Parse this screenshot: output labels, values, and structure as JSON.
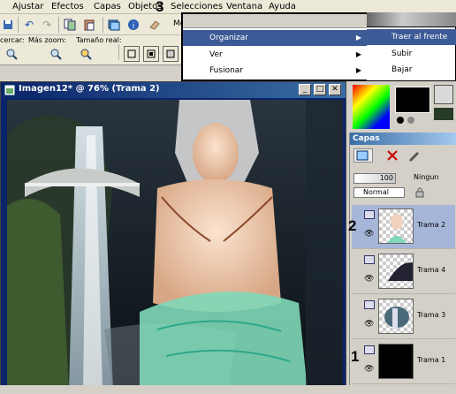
{
  "menubar": {
    "items": [
      "Ajustar",
      "Efectos",
      "Capas",
      "Objetos",
      "Selecciones",
      "Ventana",
      "Ayuda"
    ]
  },
  "toolbar": {
    "labels": [
      "cercar:",
      "Más zoom:",
      "Tamaño real:"
    ],
    "cut_text": "Mo"
  },
  "context_menu": {
    "items": [
      {
        "label": "Organizar",
        "has_submenu": true,
        "selected": true
      },
      {
        "label": "Ver",
        "has_submenu": true,
        "selected": false
      },
      {
        "label": "Fusionar",
        "has_submenu": true,
        "selected": false
      }
    ],
    "submenu": [
      {
        "label": "Traer al frente",
        "selected": true
      },
      {
        "label": "Subir",
        "selected": false
      },
      {
        "label": "Bajar",
        "selected": false
      }
    ]
  },
  "image_window": {
    "title": "Imagen12* @  76% (Trama 2)"
  },
  "layers_panel": {
    "title": "Capas",
    "opacity": "100",
    "blend_mode": "Normal",
    "mask_label": "Ningun",
    "layers": [
      {
        "name": "Trama 2",
        "active": true
      },
      {
        "name": "Trama 4",
        "active": false
      },
      {
        "name": "Trama 3",
        "active": false
      },
      {
        "name": "Trama 1",
        "active": false
      }
    ]
  },
  "steps": [
    "3",
    "2",
    "1"
  ],
  "colors": {
    "selection": "#3c5a96",
    "title_bar": "#0a246a",
    "active_layer": "#a6b6d8"
  }
}
